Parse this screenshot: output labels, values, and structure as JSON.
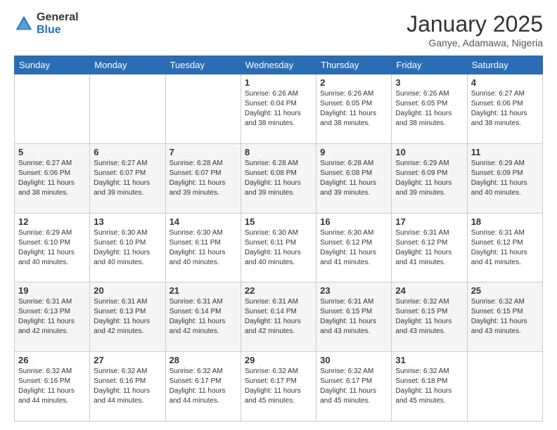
{
  "logo": {
    "general": "General",
    "blue": "Blue"
  },
  "header": {
    "month": "January 2025",
    "location": "Ganye, Adamawa, Nigeria"
  },
  "weekdays": [
    "Sunday",
    "Monday",
    "Tuesday",
    "Wednesday",
    "Thursday",
    "Friday",
    "Saturday"
  ],
  "weeks": [
    [
      {
        "day": "",
        "info": ""
      },
      {
        "day": "",
        "info": ""
      },
      {
        "day": "",
        "info": ""
      },
      {
        "day": "1",
        "info": "Sunrise: 6:26 AM\nSunset: 6:04 PM\nDaylight: 11 hours and 38 minutes."
      },
      {
        "day": "2",
        "info": "Sunrise: 6:26 AM\nSunset: 6:05 PM\nDaylight: 11 hours and 38 minutes."
      },
      {
        "day": "3",
        "info": "Sunrise: 6:26 AM\nSunset: 6:05 PM\nDaylight: 11 hours and 38 minutes."
      },
      {
        "day": "4",
        "info": "Sunrise: 6:27 AM\nSunset: 6:06 PM\nDaylight: 11 hours and 38 minutes."
      }
    ],
    [
      {
        "day": "5",
        "info": "Sunrise: 6:27 AM\nSunset: 6:06 PM\nDaylight: 11 hours and 38 minutes."
      },
      {
        "day": "6",
        "info": "Sunrise: 6:27 AM\nSunset: 6:07 PM\nDaylight: 11 hours and 39 minutes."
      },
      {
        "day": "7",
        "info": "Sunrise: 6:28 AM\nSunset: 6:07 PM\nDaylight: 11 hours and 39 minutes."
      },
      {
        "day": "8",
        "info": "Sunrise: 6:28 AM\nSunset: 6:08 PM\nDaylight: 11 hours and 39 minutes."
      },
      {
        "day": "9",
        "info": "Sunrise: 6:28 AM\nSunset: 6:08 PM\nDaylight: 11 hours and 39 minutes."
      },
      {
        "day": "10",
        "info": "Sunrise: 6:29 AM\nSunset: 6:09 PM\nDaylight: 11 hours and 39 minutes."
      },
      {
        "day": "11",
        "info": "Sunrise: 6:29 AM\nSunset: 6:09 PM\nDaylight: 11 hours and 40 minutes."
      }
    ],
    [
      {
        "day": "12",
        "info": "Sunrise: 6:29 AM\nSunset: 6:10 PM\nDaylight: 11 hours and 40 minutes."
      },
      {
        "day": "13",
        "info": "Sunrise: 6:30 AM\nSunset: 6:10 PM\nDaylight: 11 hours and 40 minutes."
      },
      {
        "day": "14",
        "info": "Sunrise: 6:30 AM\nSunset: 6:11 PM\nDaylight: 11 hours and 40 minutes."
      },
      {
        "day": "15",
        "info": "Sunrise: 6:30 AM\nSunset: 6:11 PM\nDaylight: 11 hours and 40 minutes."
      },
      {
        "day": "16",
        "info": "Sunrise: 6:30 AM\nSunset: 6:12 PM\nDaylight: 11 hours and 41 minutes."
      },
      {
        "day": "17",
        "info": "Sunrise: 6:31 AM\nSunset: 6:12 PM\nDaylight: 11 hours and 41 minutes."
      },
      {
        "day": "18",
        "info": "Sunrise: 6:31 AM\nSunset: 6:12 PM\nDaylight: 11 hours and 41 minutes."
      }
    ],
    [
      {
        "day": "19",
        "info": "Sunrise: 6:31 AM\nSunset: 6:13 PM\nDaylight: 11 hours and 42 minutes."
      },
      {
        "day": "20",
        "info": "Sunrise: 6:31 AM\nSunset: 6:13 PM\nDaylight: 11 hours and 42 minutes."
      },
      {
        "day": "21",
        "info": "Sunrise: 6:31 AM\nSunset: 6:14 PM\nDaylight: 11 hours and 42 minutes."
      },
      {
        "day": "22",
        "info": "Sunrise: 6:31 AM\nSunset: 6:14 PM\nDaylight: 11 hours and 42 minutes."
      },
      {
        "day": "23",
        "info": "Sunrise: 6:31 AM\nSunset: 6:15 PM\nDaylight: 11 hours and 43 minutes."
      },
      {
        "day": "24",
        "info": "Sunrise: 6:32 AM\nSunset: 6:15 PM\nDaylight: 11 hours and 43 minutes."
      },
      {
        "day": "25",
        "info": "Sunrise: 6:32 AM\nSunset: 6:15 PM\nDaylight: 11 hours and 43 minutes."
      }
    ],
    [
      {
        "day": "26",
        "info": "Sunrise: 6:32 AM\nSunset: 6:16 PM\nDaylight: 11 hours and 44 minutes."
      },
      {
        "day": "27",
        "info": "Sunrise: 6:32 AM\nSunset: 6:16 PM\nDaylight: 11 hours and 44 minutes."
      },
      {
        "day": "28",
        "info": "Sunrise: 6:32 AM\nSunset: 6:17 PM\nDaylight: 11 hours and 44 minutes."
      },
      {
        "day": "29",
        "info": "Sunrise: 6:32 AM\nSunset: 6:17 PM\nDaylight: 11 hours and 45 minutes."
      },
      {
        "day": "30",
        "info": "Sunrise: 6:32 AM\nSunset: 6:17 PM\nDaylight: 11 hours and 45 minutes."
      },
      {
        "day": "31",
        "info": "Sunrise: 6:32 AM\nSunset: 6:18 PM\nDaylight: 11 hours and 45 minutes."
      },
      {
        "day": "",
        "info": ""
      }
    ]
  ]
}
